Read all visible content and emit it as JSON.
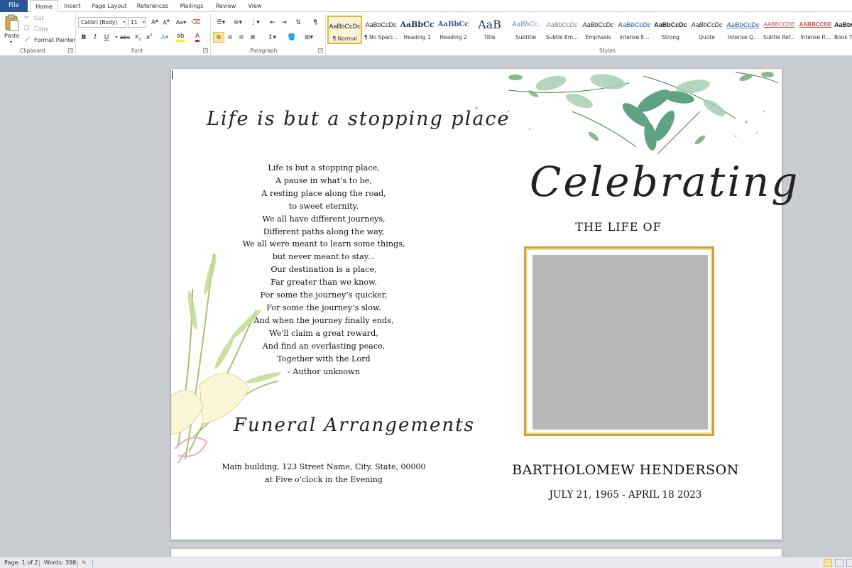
{
  "tabs": {
    "file": "File",
    "items": [
      "Home",
      "Insert",
      "Page Layout",
      "References",
      "Mailings",
      "Review",
      "View"
    ]
  },
  "ribbon": {
    "clipboard": {
      "paste": "Paste",
      "cut": "Cut",
      "copy": "Copy",
      "format_painter": "Format Painter",
      "label": "Clipboard"
    },
    "font": {
      "name": "Calibri (Body)",
      "size": "11",
      "label": "Font"
    },
    "paragraph": {
      "label": "Paragraph"
    },
    "styles": {
      "label": "Styles",
      "items": [
        {
          "sample": "AaBbCcDc",
          "name": "¶ Normal"
        },
        {
          "sample": "AaBbCcDc",
          "name": "¶ No Spaci..."
        },
        {
          "sample": "AaBbCc",
          "name": "Heading 1"
        },
        {
          "sample": "AaBbCc",
          "name": "Heading 2"
        },
        {
          "sample": "AaB",
          "name": "Title"
        },
        {
          "sample": "AaBbCc.",
          "name": "Subtitle"
        },
        {
          "sample": "AaBbCcDc",
          "name": "Subtle Em..."
        },
        {
          "sample": "AaBbCcDc",
          "name": "Emphasis"
        },
        {
          "sample": "AaBbCcDc",
          "name": "Intense E..."
        },
        {
          "sample": "AaBbCcDc",
          "name": "Strong"
        },
        {
          "sample": "AaBbCcDc",
          "name": "Quote"
        },
        {
          "sample": "AaBbCcDc",
          "name": "Intense Q..."
        },
        {
          "sample": "AABBCCDE",
          "name": "Subtle Ref..."
        },
        {
          "sample": "AABBCCDE",
          "name": "Intense R..."
        },
        {
          "sample": "AaBbCcDc",
          "name": "Book Ti..."
        }
      ]
    }
  },
  "document": {
    "left": {
      "script_title": "Life is but a stopping place",
      "poem": [
        "Life is but a stopping place,",
        "A pause in what’s to be,",
        "A resting place along the road,",
        "to sweet eternity.",
        "We all have different journeys,",
        "Different paths along the way,",
        "We all were meant to learn some things,",
        "but never meant to stay...",
        "Our destination is a place,",
        "Far greater than we know.",
        "For some the journey’s quicker,",
        "For some the journey’s slow.",
        "And when the journey finally ends,",
        "We'll claim a great reward,",
        "And find an everlasting peace,",
        "Together with the Lord",
        "- Author unknown"
      ],
      "arrangements_title": "Funeral Arrangements",
      "address": "Main building, 123 Street Name, City, State, 00000",
      "time": "at Five o’clock in the Evening"
    },
    "right": {
      "celebrating": "Celebrating",
      "the_life_of": "THE LIFE OF",
      "name": "BARTHOLOMEW HENDERSON",
      "dates": "JULY 21, 1965 - APRIL 18 2023"
    }
  },
  "status": {
    "page": "Page: 1 of 2",
    "words": "Words: 398"
  },
  "colors": {
    "file_tab": "#2b579a",
    "frame_gold": "#c9a63b",
    "photo_gray": "#b8b8b8",
    "leaf_green": "#7fb58f"
  }
}
